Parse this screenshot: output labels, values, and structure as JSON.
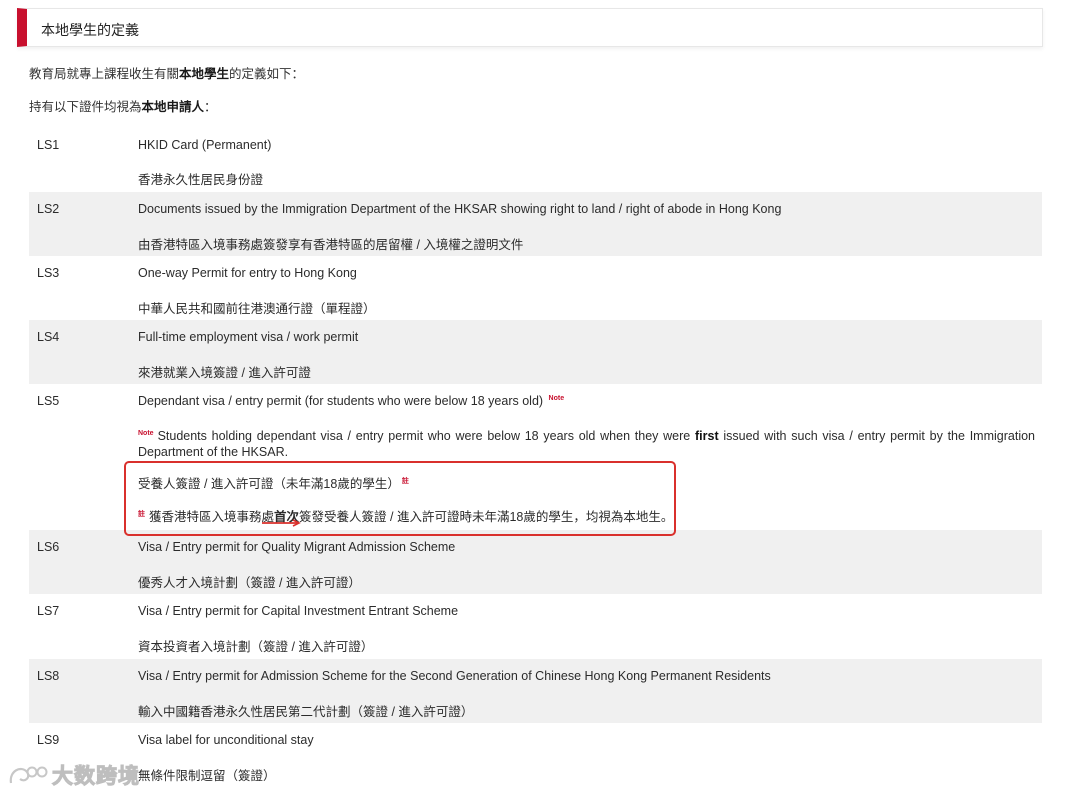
{
  "header": {
    "title": "本地學生的定義"
  },
  "intro": {
    "line1_prefix": "教育局就專上課程收生有關",
    "line1_bold": "本地學生",
    "line1_suffix": "的定義如下：",
    "line2_prefix": "持有以下證件均視為",
    "line2_bold": "本地申請人",
    "line2_suffix": "："
  },
  "rows": [
    {
      "code": "LS1",
      "en": "HKID Card (Permanent)",
      "zh": "香港永久性居民身份證"
    },
    {
      "code": "LS2",
      "en": "Documents issued by the Immigration Department of the HKSAR showing right to land / right of abode in Hong Kong",
      "zh": "由香港特區入境事務處簽發享有香港特區的居留權 / 入境權之證明文件"
    },
    {
      "code": "LS3",
      "en": "One-way Permit for entry to Hong Kong",
      "zh": "中華人民共和國前往港澳通行證（單程證）"
    },
    {
      "code": "LS4",
      "en": "Full-time employment visa / work permit",
      "zh": "來港就業入境簽證 / 進入許可證"
    },
    {
      "code": "LS5",
      "en": "Dependant visa / entry permit (for students who were below 18 years old)",
      "en_note_marker": "Note",
      "note_label": "Note",
      "note_text_before": "Students holding dependant visa / entry permit who were below 18 years old when they were ",
      "note_text_bold": "first",
      "note_text_after": " issued with such visa / entry permit by the Immigration Department of the HKSAR.",
      "zh": "受養人簽證 / 進入許可證（未年滿18歲的學生）",
      "zh_note_marker": "註",
      "zh_note_label": "註",
      "zh_note_before": "獲香港特區入境事務處",
      "zh_note_bold": "首次",
      "zh_note_after": "簽發受養人簽證 / 進入許可證時未年滿18歲的學生，均視為本地生。"
    },
    {
      "code": "LS6",
      "en": "Visa / Entry permit for Quality Migrant Admission Scheme",
      "zh": "優秀人才入境計劃（簽證 / 進入許可證）"
    },
    {
      "code": "LS7",
      "en": "Visa / Entry permit for Capital Investment Entrant Scheme",
      "zh": "資本投資者入境計劃（簽證 / 進入許可證）"
    },
    {
      "code": "LS8",
      "en": "Visa / Entry permit for Admission Scheme for the Second Generation of Chinese Hong Kong Permanent Residents",
      "zh": "輸入中國籍香港永久性居民第二代計劃（簽證 / 進入許可證）"
    },
    {
      "code": "LS9",
      "en": "Visa label for unconditional stay",
      "zh": "無條件限制逗留（簽證）"
    }
  ],
  "watermark": {
    "text": "大数跨境"
  },
  "colors": {
    "accent": "#c8102e",
    "highlight": "#d9302c",
    "row_shade": "#f0f0f0"
  }
}
